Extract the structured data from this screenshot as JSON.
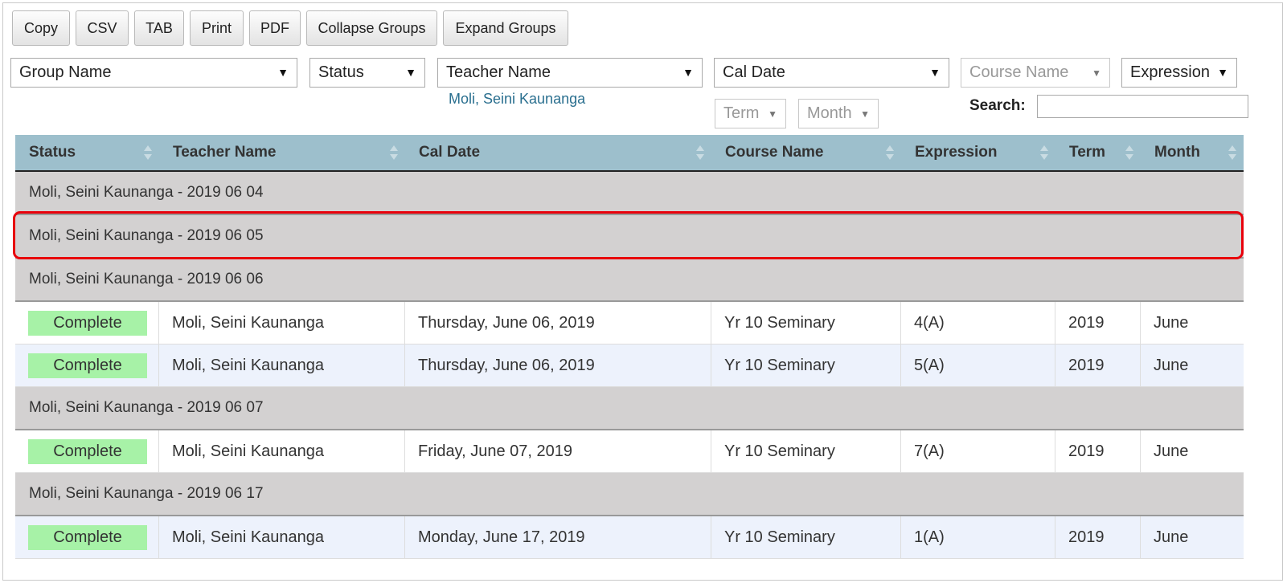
{
  "toolbar": {
    "buttons": [
      "Copy",
      "CSV",
      "TAB",
      "Print",
      "PDF",
      "Collapse Groups",
      "Expand Groups"
    ]
  },
  "filters": {
    "group_name": "Group Name",
    "status": "Status",
    "teacher_name": "Teacher Name",
    "teacher_selected": "Moli, Seini Kaunanga",
    "cal_date": "Cal Date",
    "course_name": "Course Name",
    "expression": "Expression",
    "term": "Term",
    "month": "Month",
    "search_label": "Search:",
    "search_value": ""
  },
  "table": {
    "headers": [
      "Status",
      "Teacher Name",
      "Cal Date",
      "Course Name",
      "Expression",
      "Term",
      "Month"
    ],
    "groups": [
      "Moli, Seini Kaunanga - 2019 06 04",
      "Moli, Seini Kaunanga - 2019 06 05",
      "Moli, Seini Kaunanga - 2019 06 06",
      "Moli, Seini Kaunanga - 2019 06 07",
      "Moli, Seini Kaunanga - 2019 06 17"
    ],
    "rows": [
      {
        "status": "Complete",
        "teacher": "Moli, Seini Kaunanga",
        "date": "Thursday, June 06, 2019",
        "course": "Yr 10 Seminary",
        "expression": "4(A)",
        "term": "2019",
        "month": "June"
      },
      {
        "status": "Complete",
        "teacher": "Moli, Seini Kaunanga",
        "date": "Thursday, June 06, 2019",
        "course": "Yr 10 Seminary",
        "expression": "5(A)",
        "term": "2019",
        "month": "June"
      },
      {
        "status": "Complete",
        "teacher": "Moli, Seini Kaunanga",
        "date": "Friday, June 07, 2019",
        "course": "Yr 10 Seminary",
        "expression": "7(A)",
        "term": "2019",
        "month": "June"
      },
      {
        "status": "Complete",
        "teacher": "Moli, Seini Kaunanga",
        "date": "Monday, June 17, 2019",
        "course": "Yr 10 Seminary",
        "expression": "1(A)",
        "term": "2019",
        "month": "June"
      }
    ]
  },
  "colors": {
    "header_bg": "#9dbfcc",
    "group_bg": "#d3d1d1",
    "complete_badge": "#a7f2a7",
    "highlight": "#e8000b",
    "alt_row": "#edf2fc"
  }
}
